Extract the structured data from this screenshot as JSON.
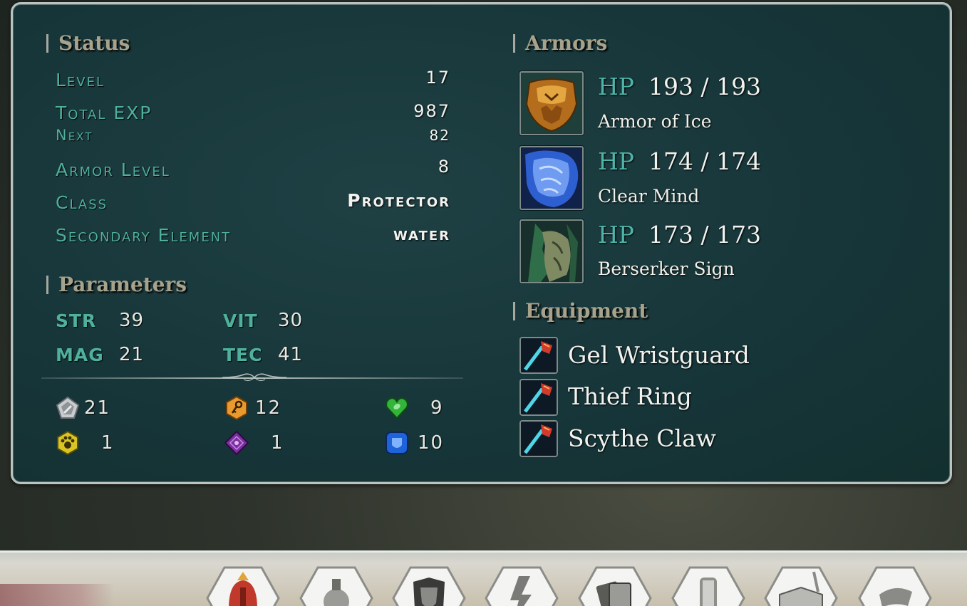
{
  "status": {
    "heading": "Status",
    "rows": [
      {
        "label": "Level",
        "value": "17"
      },
      {
        "label": "Total EXP",
        "value": "987"
      },
      {
        "label": "Next",
        "value": "82"
      },
      {
        "label": "Armor Level",
        "value": "8"
      },
      {
        "label": "Class",
        "value": "Protector"
      },
      {
        "label": "Secondary Element",
        "value": "water"
      }
    ]
  },
  "parameters": {
    "heading": "Parameters",
    "stats": [
      {
        "label": "STR",
        "value": "39"
      },
      {
        "label": "VIT",
        "value": "30"
      },
      {
        "label": "MAG",
        "value": "21"
      },
      {
        "label": "TEC",
        "value": "41"
      }
    ],
    "items": [
      {
        "icon": "silver-pentagon-gem-icon",
        "count": "21"
      },
      {
        "icon": "orange-key-gem-icon",
        "count": "12"
      },
      {
        "icon": "green-heart-gem-icon",
        "count": "9"
      },
      {
        "icon": "yellow-paw-gem-icon",
        "count": "1"
      },
      {
        "icon": "purple-diamond-gem-icon",
        "count": "1"
      },
      {
        "icon": "blue-shield-gem-icon",
        "count": "10"
      }
    ]
  },
  "armors": {
    "heading": "Armors",
    "list": [
      {
        "hp_label": "HP",
        "hp": "193 / 193",
        "name": "Armor of Ice"
      },
      {
        "hp_label": "HP",
        "hp": "174 / 174",
        "name": "Clear Mind"
      },
      {
        "hp_label": "HP",
        "hp": "173 / 173",
        "name": "Berserker Sign"
      }
    ]
  },
  "equipment": {
    "heading": "Equipment",
    "list": [
      {
        "name": "Gel Wristguard"
      },
      {
        "name": "Thief Ring"
      },
      {
        "name": "Scythe Claw"
      }
    ]
  },
  "menu": {
    "tabs": [
      {
        "icon": "helmet-icon"
      },
      {
        "icon": "potion-icon"
      },
      {
        "icon": "armor-icon"
      },
      {
        "icon": "skill-icon"
      },
      {
        "icon": "cards-icon"
      },
      {
        "icon": "scroll-icon"
      },
      {
        "icon": "book-icon"
      },
      {
        "icon": "settings-icon"
      }
    ]
  }
}
